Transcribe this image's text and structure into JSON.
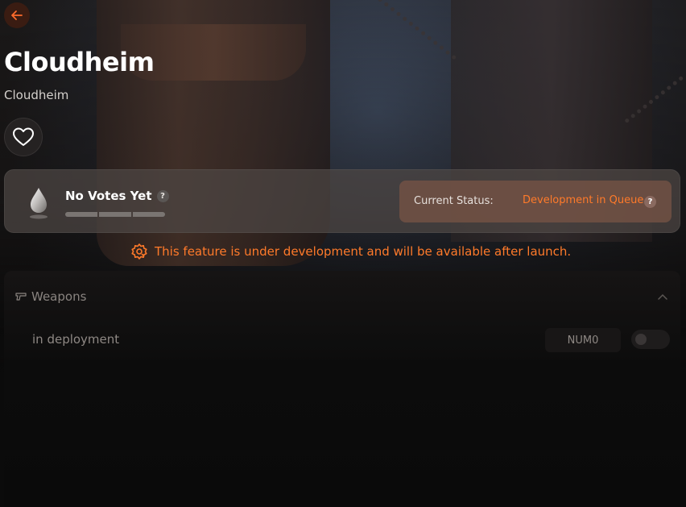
{
  "header": {
    "back_icon": "arrow-left-icon",
    "title": "Cloudheim",
    "subtitle": "Cloudheim",
    "favorite_icon": "heart-icon"
  },
  "votes": {
    "title": "No Votes Yet",
    "help": "?",
    "bar_count": 3,
    "status_label": "Current Status:",
    "status_value": "Development in Queue",
    "status_help": "?"
  },
  "notice": {
    "text": "This feature is under development and will be available after launch."
  },
  "weapons": {
    "section_title": "Weapons",
    "row_label": "in deployment",
    "hotkey": "NUM0",
    "toggle_on": false
  },
  "colors": {
    "accent": "#ff7a2a",
    "back_button_bg": "#3a1c12"
  }
}
